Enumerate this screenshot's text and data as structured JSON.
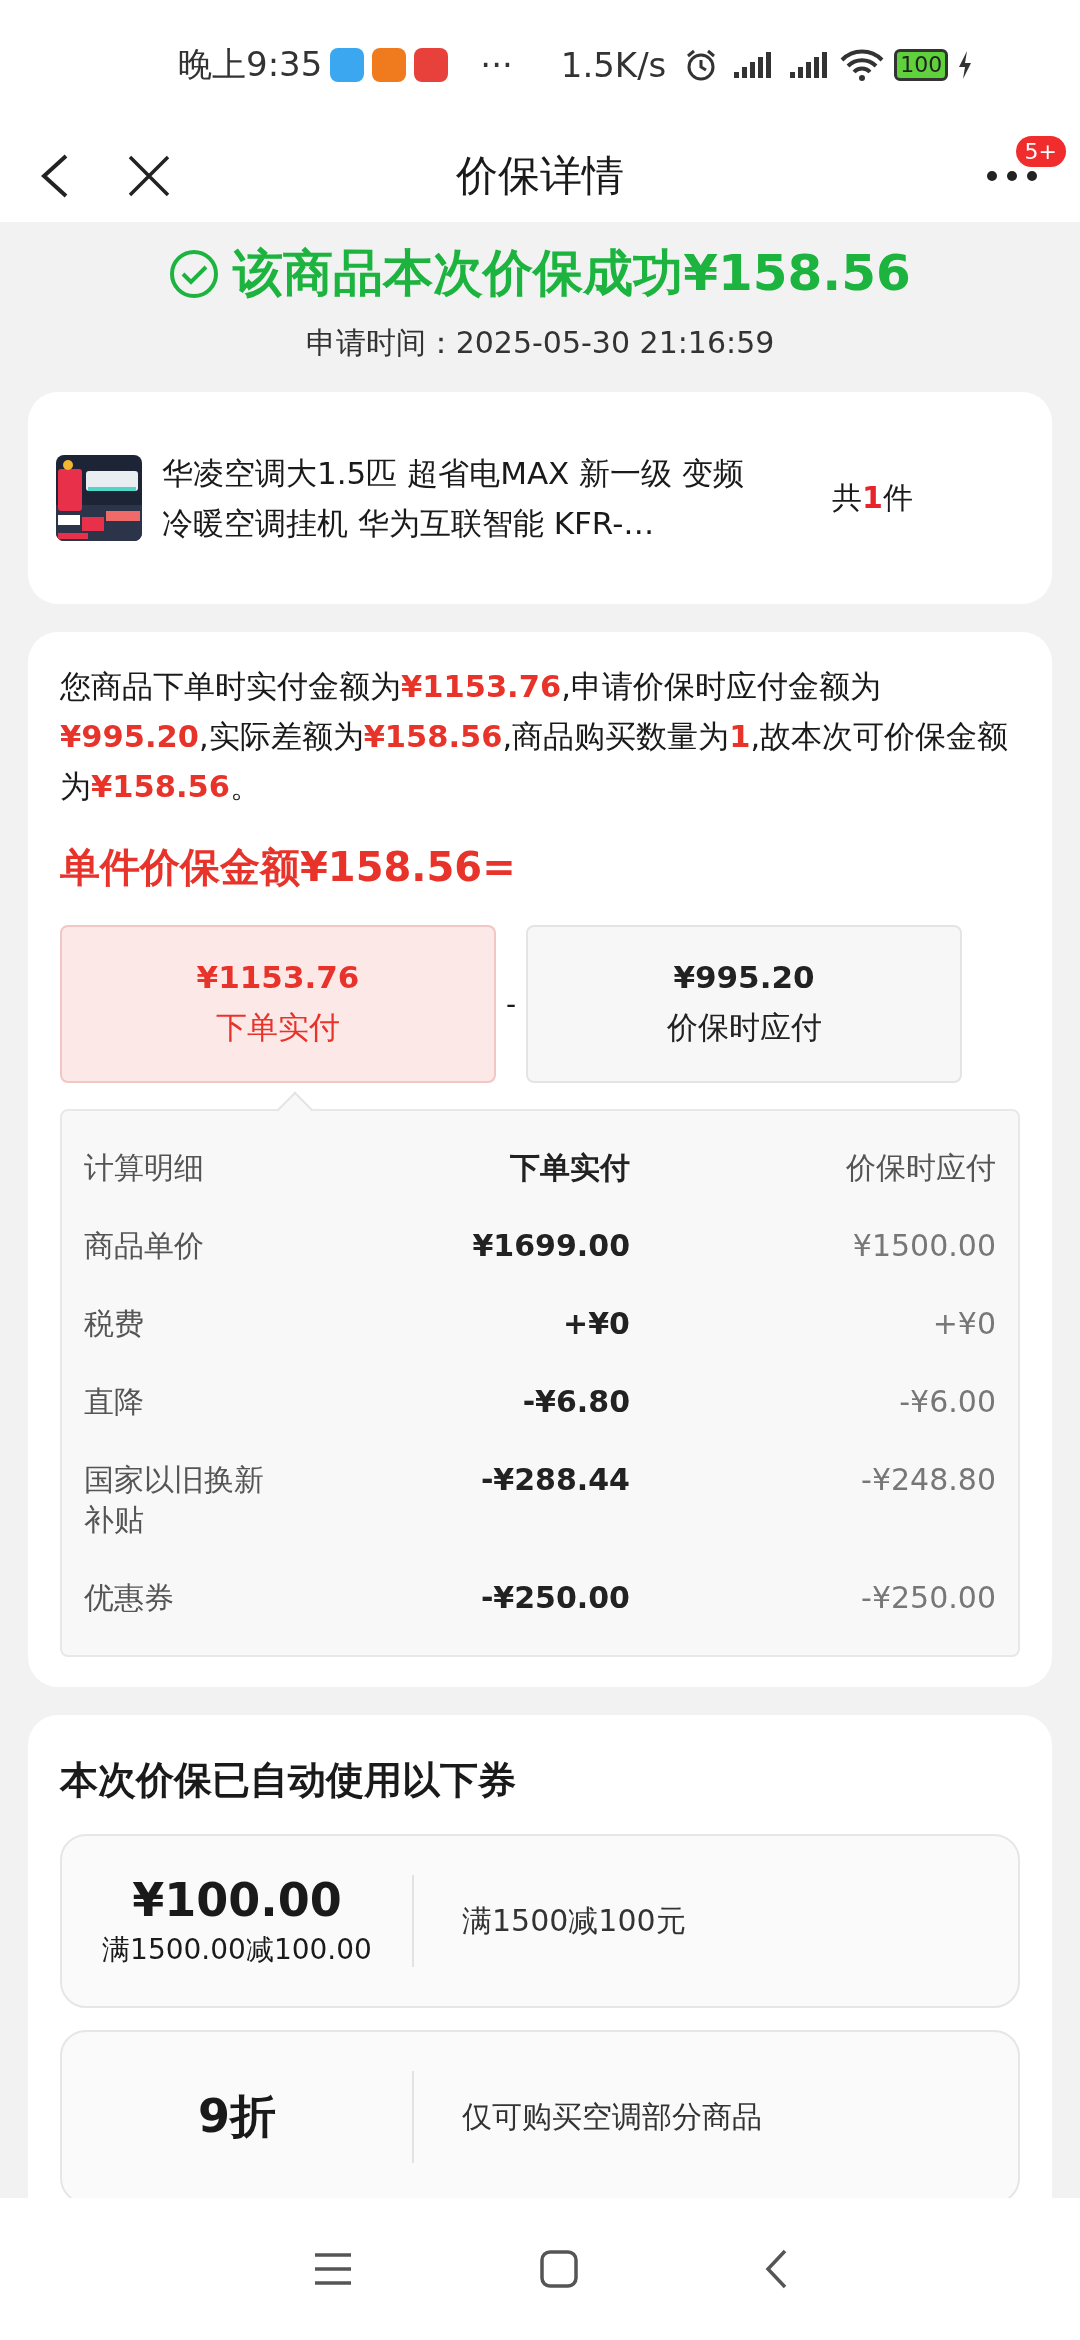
{
  "status_bar": {
    "time": "晚上9:35",
    "more": "···",
    "speed": "1.5K/s",
    "battery": "100"
  },
  "header": {
    "title": "价保详情",
    "badge": "5+"
  },
  "summary": {
    "headline": "该商品本次价保成功¥158.56",
    "apply_time": "申请时间：2025-05-30 21:16:59"
  },
  "product": {
    "title_lines": [
      "华凌空调大1.5匹 超省电MAX 新一级 变频",
      "冷暖空调挂机 华为互联智能 KFR-…"
    ],
    "quantity": "共**1**件"
  },
  "explanation": {
    "text": "您商品下单时实付金额为**¥1153.76**,申请价保时应付金额为**¥995.20**,实际差额为**¥158.56**,商品购买数量为**1**,故本次可价保金额为**¥158.56**。",
    "formula_title": "单件价保金额¥158.56=",
    "operator": "-",
    "boxes": [
      {
        "amount": "¥1153.76",
        "label": "下单实付",
        "selected": true
      },
      {
        "amount": "¥995.20",
        "label": "价保时应付",
        "selected": false
      }
    ]
  },
  "breakdown": {
    "columns": [
      "计算明细",
      "下单实付",
      "价保时应付"
    ],
    "rows": [
      {
        "name": "商品单价",
        "paid": "¥1699.00",
        "now": "¥1500.00"
      },
      {
        "name": "税费",
        "paid": "+¥0",
        "now": "+¥0"
      },
      {
        "name": "直降",
        "paid": "-¥6.80",
        "now": "-¥6.00"
      },
      {
        "name": "国家以旧换新补贴",
        "paid": "-¥288.44",
        "now": "-¥248.80"
      },
      {
        "name": "优惠券",
        "paid": "-¥250.00",
        "now": "-¥250.00"
      }
    ]
  },
  "coupons": {
    "title": "本次价保已自动使用以下券",
    "items": [
      {
        "amount": "¥100.00",
        "condition": "满1500.00减100.00",
        "description": "满1500减100元"
      },
      {
        "amount": "9折",
        "description": "仅可购买空调部分商品"
      }
    ]
  }
}
